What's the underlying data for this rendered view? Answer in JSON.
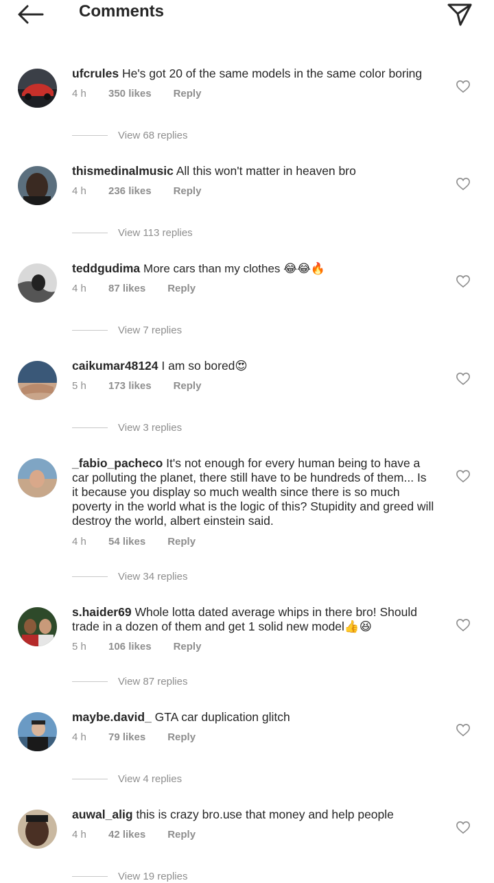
{
  "header": {
    "title": "Comments"
  },
  "icons": {
    "back": "back-arrow-icon",
    "share": "paper-plane-icon",
    "like": "heart-outline-icon"
  },
  "colors": {
    "text": "#262626",
    "secondary": "#8e8e8e"
  },
  "comments": [
    {
      "username": "ufcrules",
      "text": "He's got 20 of the same models in the same color boring",
      "time": "4 h",
      "likes": "350 likes",
      "reply": "Reply",
      "view_replies": "View 68 replies"
    },
    {
      "username": "thismedinalmusic",
      "text": "All this won't matter in heaven bro",
      "time": "4 h",
      "likes": "236 likes",
      "reply": "Reply",
      "view_replies": "View 113 replies"
    },
    {
      "username": "teddgudima",
      "text": "More cars than my clothes 😂😂🔥",
      "time": "4 h",
      "likes": "87 likes",
      "reply": "Reply",
      "view_replies": "View 7 replies"
    },
    {
      "username": "caikumar48124",
      "text": "I am so bored😍",
      "time": "5 h",
      "likes": "173 likes",
      "reply": "Reply",
      "view_replies": "View 3 replies"
    },
    {
      "username": "_fabio_pacheco",
      "text": "It's not enough for every human being to have a car polluting the planet, there still have to be hundreds of them... Is it because you display so much wealth since there is so much poverty in the world what is the logic of this? Stupidity and greed will destroy the world, albert einstein said.",
      "time": "4 h",
      "likes": "54 likes",
      "reply": "Reply",
      "view_replies": "View 34 replies"
    },
    {
      "username": "s.haider69",
      "text": "Whole lotta dated average whips in there bro! Should trade in a dozen of them and get 1 solid new model👍😆",
      "time": "5 h",
      "likes": "106 likes",
      "reply": "Reply",
      "view_replies": "View 87 replies"
    },
    {
      "username": "maybe.david_",
      "text": "GTA car duplication glitch",
      "time": "4 h",
      "likes": "79 likes",
      "reply": "Reply",
      "view_replies": "View 4 replies"
    },
    {
      "username": "auwal_alig",
      "text": "this is crazy bro.use that money and help people",
      "time": "4 h",
      "likes": "42 likes",
      "reply": "Reply",
      "view_replies": "View 19 replies"
    }
  ]
}
